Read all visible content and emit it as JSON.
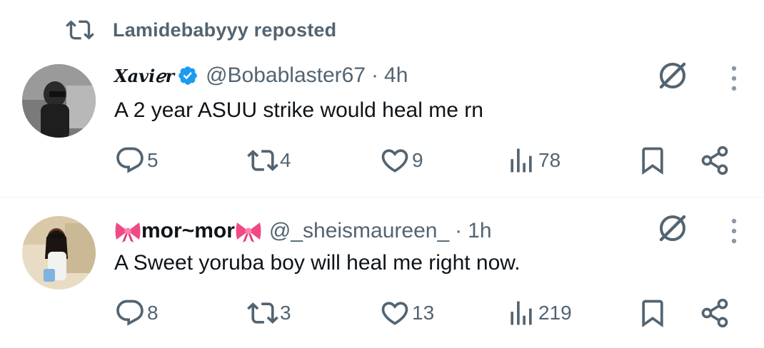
{
  "repost": {
    "label": "Lamidebabyyy reposted"
  },
  "tweets": [
    {
      "display_name": "Xaviℯr",
      "handle": "@Bobablaster67",
      "separator": "·",
      "time": "4h",
      "text": "A 2 year ASUU strike would heal me rn",
      "replies": "5",
      "reposts": "4",
      "likes": "9",
      "views": "78"
    },
    {
      "display_name": "mor~mor",
      "handle": "@_sheismaureen_",
      "separator": "·",
      "time": "1h",
      "text": "A Sweet yoruba boy will heal me right now.",
      "replies": "8",
      "reposts": "3",
      "likes": "13",
      "views": "219"
    }
  ],
  "colors": {
    "muted": "#536471",
    "text": "#0f1419",
    "verified": "#1d9bf0",
    "bow": "#f04a86",
    "divider": "#eff3f4"
  },
  "icons": [
    "repost-icon",
    "verified-badge-icon",
    "grok-icon",
    "more-icon",
    "reply-icon",
    "like-icon",
    "views-icon",
    "bookmark-icon",
    "share-icon",
    "ribbon-bow-icon"
  ]
}
